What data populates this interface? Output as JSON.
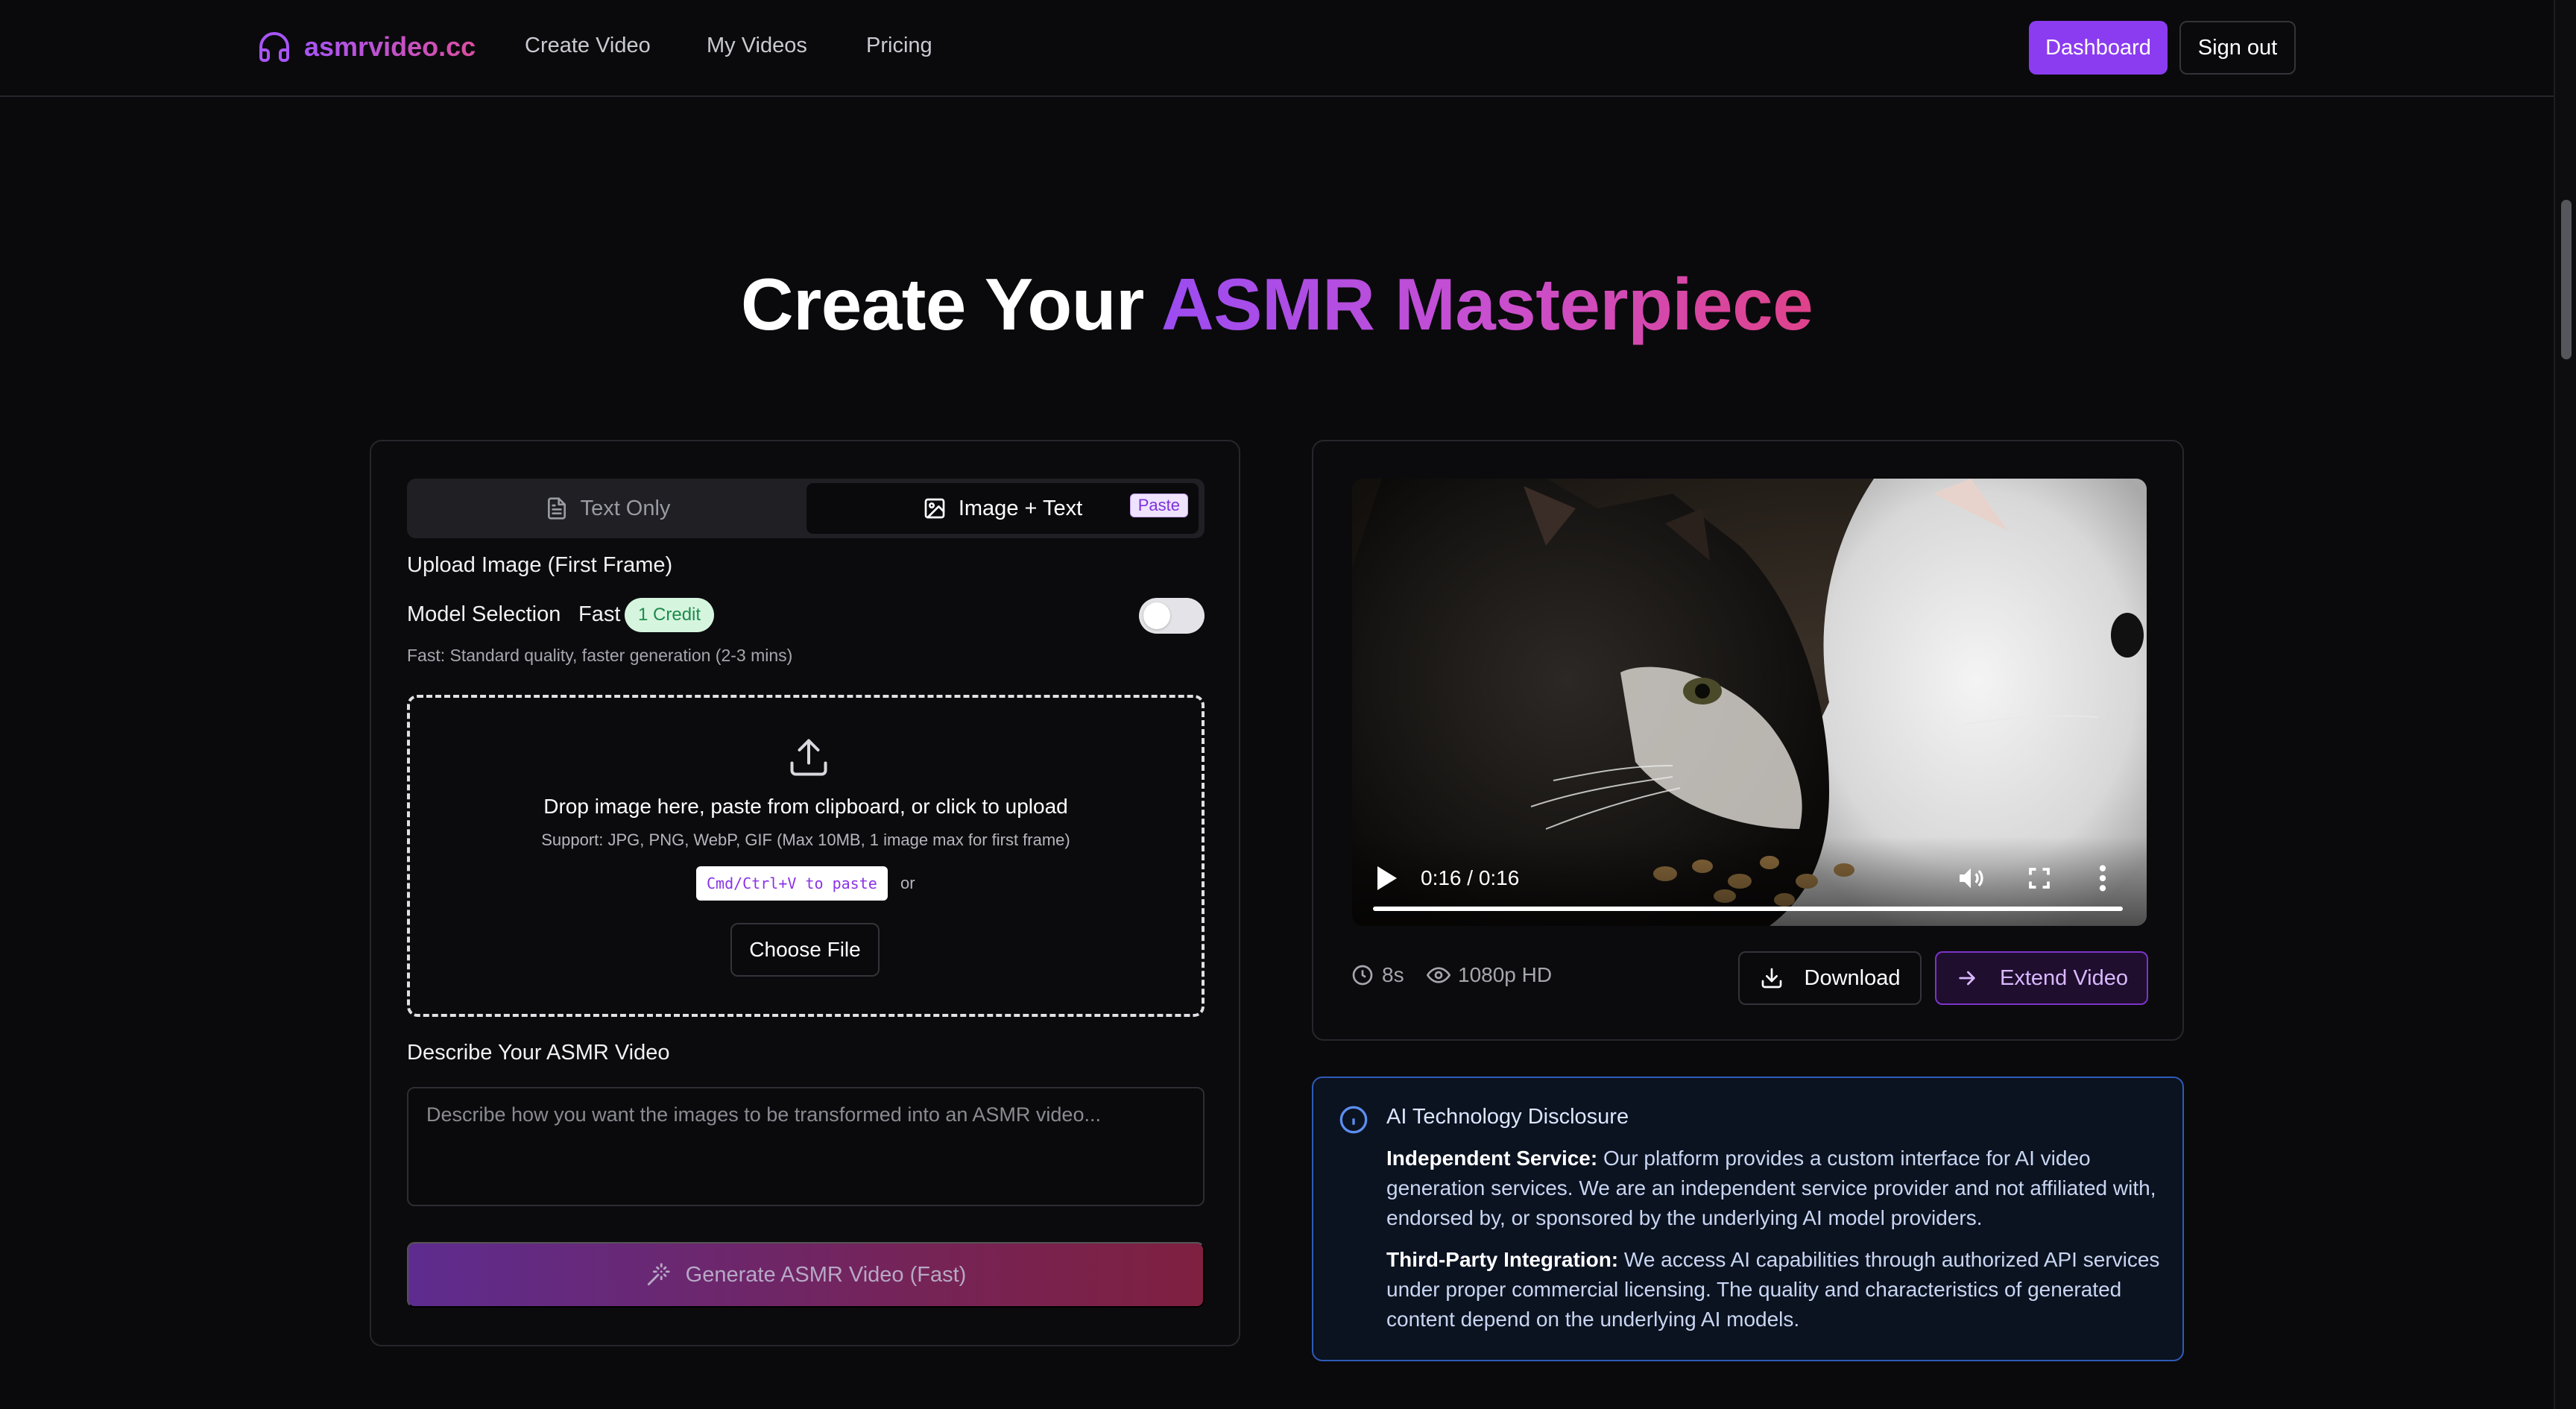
{
  "nav": {
    "brand": "asmrvideo.cc",
    "links": [
      "Create Video",
      "My Videos",
      "Pricing"
    ],
    "dashboard": "Dashboard",
    "signout": "Sign out"
  },
  "hero": {
    "title_plain": "Create Your ",
    "title_highlight": "ASMR Masterpiece"
  },
  "left": {
    "tabs": {
      "text_only": "Text Only",
      "image_text": "Image + Text",
      "paste_badge": "Paste"
    },
    "upload_label": "Upload Image (First Frame)",
    "model_label": "Model Selection",
    "model_value": "Fast",
    "credit_badge": "1 Credit",
    "model_hint": "Fast: Standard quality, faster generation (2-3 mins)",
    "dropzone": {
      "title": "Drop image here, paste from clipboard, or click to upload",
      "sub": "Support: JPG, PNG, WebP, GIF (Max 10MB, 1 image max for first frame)",
      "paste_hint": "Cmd/Ctrl+V to paste",
      "or": "or",
      "choose": "Choose File"
    },
    "describe_label": "Describe Your ASMR Video",
    "describe_placeholder": "Describe how you want the images to be transformed into an ASMR video...",
    "generate": "Generate ASMR Video (Fast)"
  },
  "video": {
    "time": "0:16 / 0:16",
    "progress": 1.0,
    "duration": "8s",
    "quality": "1080p HD",
    "download": "Download",
    "extend": "Extend Video"
  },
  "disclosure": {
    "title": "AI Technology Disclosure",
    "p1_bold": "Independent Service:",
    "p1_text": " Our platform provides a custom interface for AI video generation services. We are an independent service provider and not affiliated with, endorsed by, or sponsored by the underlying AI model providers.",
    "p2_bold": "Third-Party Integration:",
    "p2_text": " We access AI capabilities through authorized API services under proper commercial licensing. The quality and characteristics of generated content depend on the underlying AI models."
  },
  "colors": {
    "accent": "#8b3cf0",
    "info_border": "#2f5bb8",
    "credit_bg": "#d6f5df"
  },
  "icons": [
    "headphones-icon",
    "document-icon",
    "image-icon",
    "upload-icon",
    "magic-wand-icon",
    "play-icon",
    "volume-icon",
    "fullscreen-icon",
    "more-icon",
    "clock-icon",
    "eye-icon",
    "download-icon",
    "arrow-right-icon",
    "info-icon"
  ]
}
